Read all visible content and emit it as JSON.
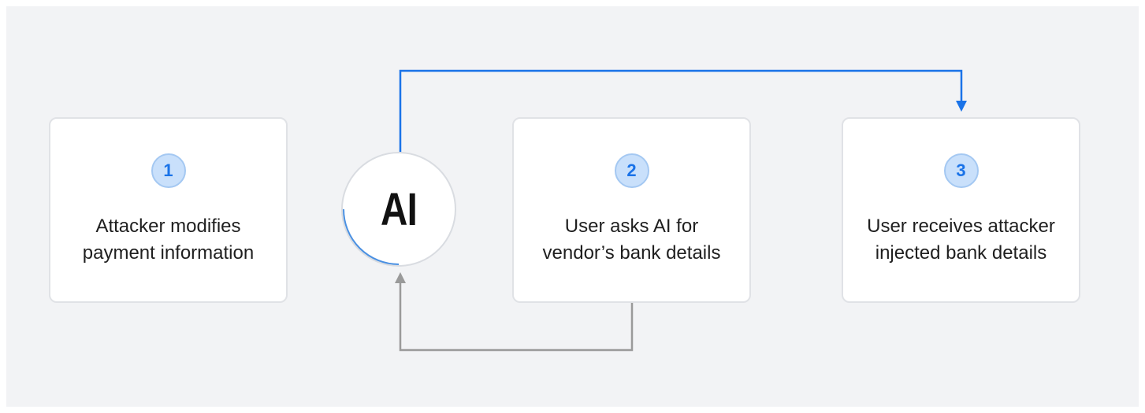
{
  "diagram": {
    "ai_node": {
      "label": "AI"
    },
    "steps": [
      {
        "number": "1",
        "lines": [
          "Attacker modifies",
          "payment information"
        ]
      },
      {
        "number": "2",
        "lines": [
          "User asks AI for",
          "vendor’s bank details"
        ]
      },
      {
        "number": "3",
        "lines": [
          "User receives attacker",
          "injected bank details"
        ]
      }
    ],
    "colors": {
      "background": "#f2f3f5",
      "card": "#ffffff",
      "card_border": "#e0e2e6",
      "badge_fill": "#c9e0fb",
      "badge_text": "#1a73e8",
      "blue_arrow": "#1a73e8",
      "gray_arrow": "#9a9a9a"
    }
  }
}
